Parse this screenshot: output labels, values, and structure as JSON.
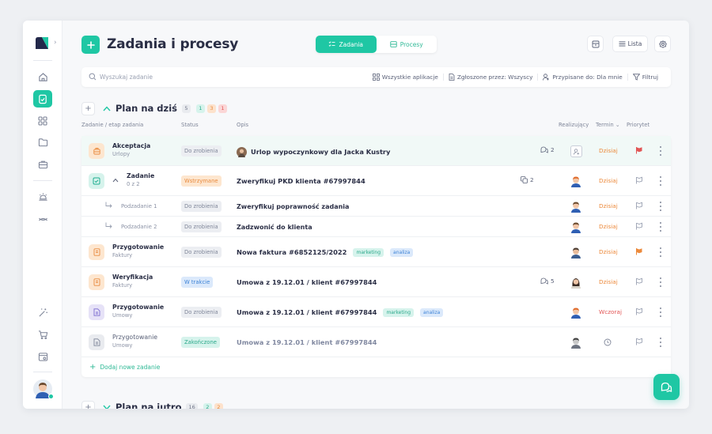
{
  "header": {
    "title": "Zadania i procesy",
    "tabs": [
      {
        "label": "Zadania",
        "active": true
      },
      {
        "label": "Procesy",
        "active": false
      }
    ],
    "view_label": "Lista"
  },
  "search": {
    "placeholder": "Wyszukaj zadanie"
  },
  "filters": [
    {
      "label": "Wszystkie aplikacje",
      "icon": "grid-icon"
    },
    {
      "label": "Zgłoszone przez: Wszyscy",
      "icon": "document-icon"
    },
    {
      "label": "Przypisane do: Dla mnie",
      "icon": "user-add-icon"
    },
    {
      "label": "Filtruj",
      "icon": "filter-icon"
    }
  ],
  "group_today": {
    "title": "Plan na dziś",
    "counts": [
      "5",
      "1",
      "3",
      "1"
    ]
  },
  "group_tomorrow": {
    "title": "Plan na jutro",
    "counts": [
      "16",
      "2",
      "2"
    ]
  },
  "columns": {
    "task": "Zadanie / etap zadania",
    "status": "Status",
    "desc": "Opis",
    "assignee": "Realizujący",
    "term": "Termin",
    "priority": "Priorytet"
  },
  "rows": [
    {
      "name": "Akceptacja",
      "sub": "Urlopy",
      "status": "Do zrobienia",
      "desc": "Urlop wypoczynkowy dla Jacka Kustry",
      "comments": "2",
      "term": "Dzisiaj"
    },
    {
      "name": "Zadanie",
      "sub": "0 z 2",
      "status": "Wstrzymane",
      "desc": "Zweryfikuj PKD klienta #67997844",
      "comments": "2",
      "term": "Dzisiaj"
    },
    {
      "name": "Podzadanie 1",
      "status": "Do zrobienia",
      "desc": "Zweryfikuj poprawność zadania",
      "term": "Dzisiaj"
    },
    {
      "name": "Podzadanie 2",
      "status": "Do zrobienia",
      "desc": "Zadzwonić do klienta",
      "term": "Dzisiaj"
    },
    {
      "name": "Przygotowanie",
      "sub": "Faktury",
      "status": "Do zrobienia",
      "desc": "Nowa faktura #6852125/2022",
      "tags": [
        "marketing",
        "analiza"
      ],
      "term": "Dzisiaj"
    },
    {
      "name": "Weryfikacja",
      "sub": "Faktury",
      "status": "W trakcie",
      "desc": "Umowa z 19.12.01 / klient #67997844",
      "comments": "5",
      "term": "Dzisiaj"
    },
    {
      "name": "Przygotowanie",
      "sub": "Umowy",
      "status": "Do zrobienia",
      "desc": "Umowa z 19.12.01 / klient #67997844",
      "tags": [
        "marketing",
        "analiza"
      ],
      "term": "Wczoraj"
    },
    {
      "name": "Przygotowanie",
      "sub": "Umowy",
      "status": "Zakończone",
      "desc": "Umowa z 19.12.01 / klient #67997844"
    }
  ],
  "add_task_label": "Dodaj nowe zadanie",
  "colors": {
    "accent": "#1fc7a4",
    "orange": "#ec8a3c",
    "red": "#e25555",
    "blue": "#3b82d6"
  }
}
